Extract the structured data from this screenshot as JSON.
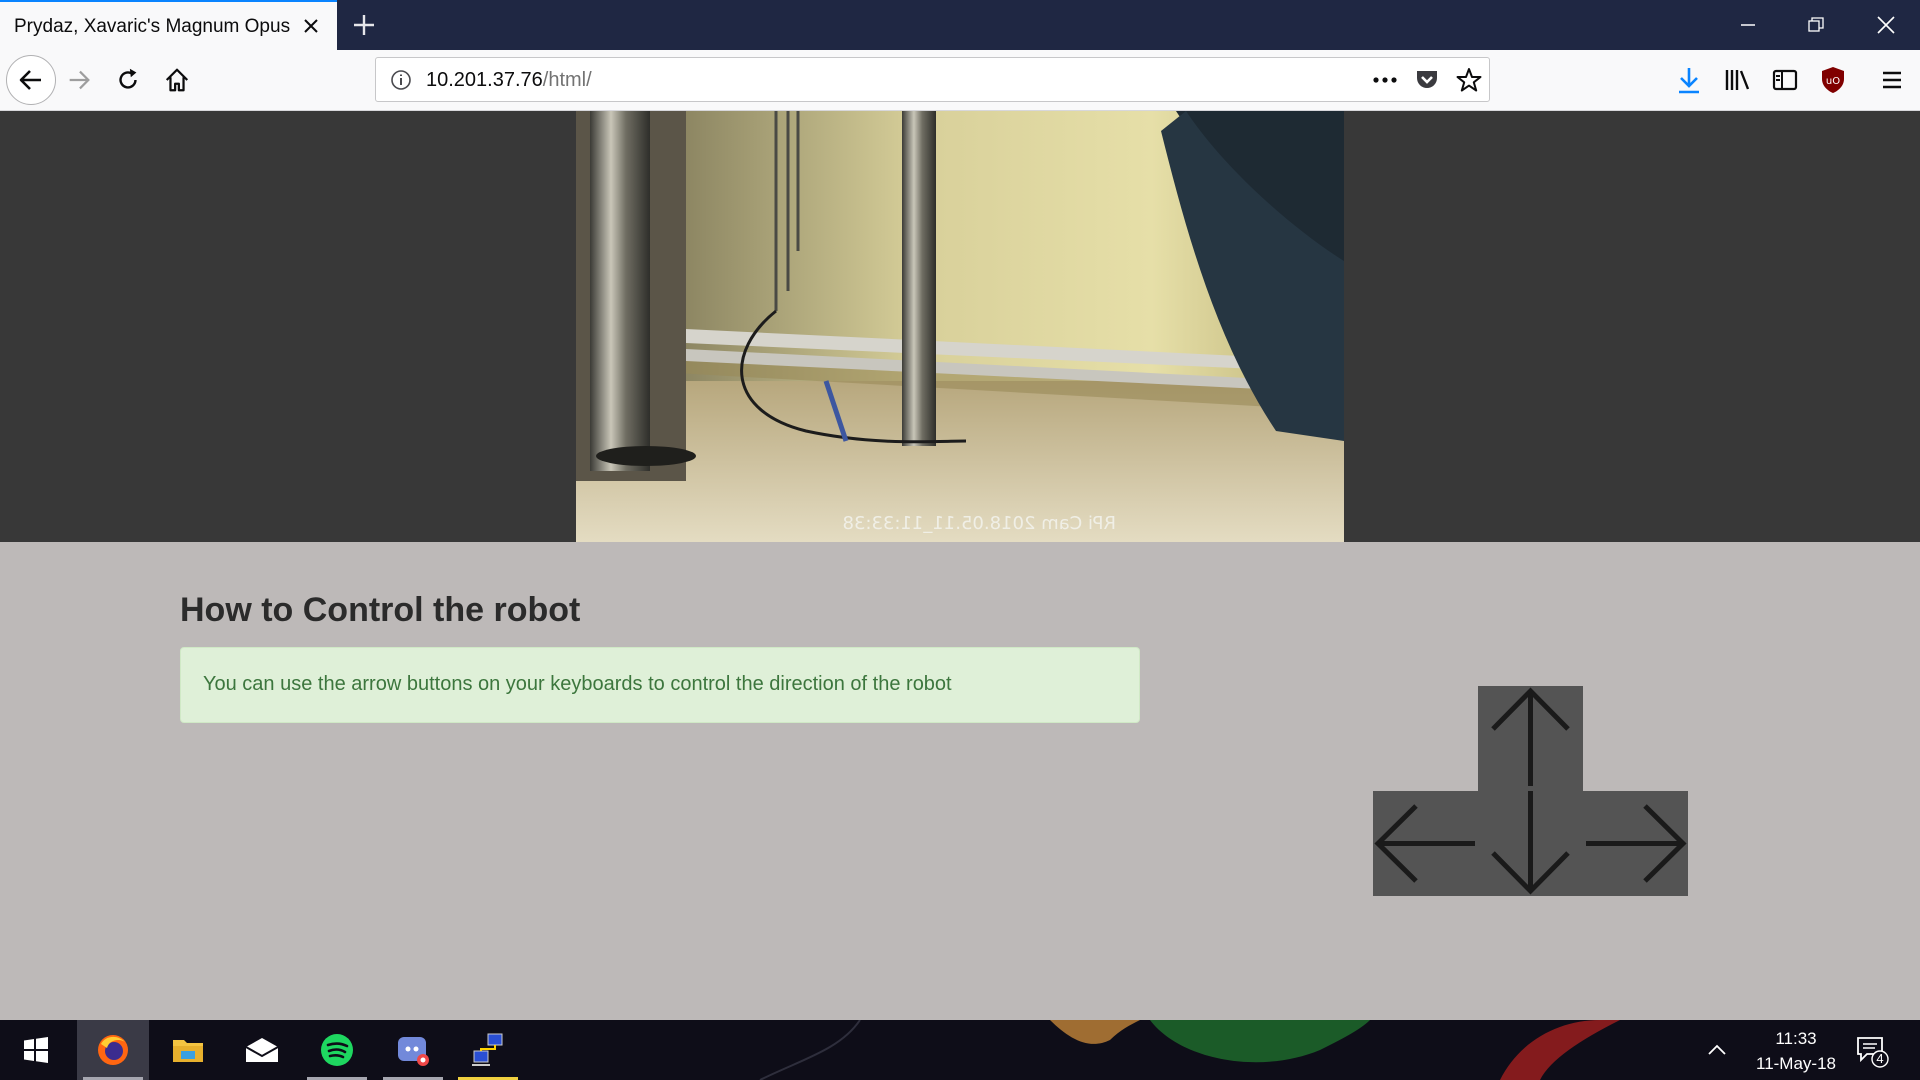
{
  "browser": {
    "tab_title": "Prydaz, Xavaric's Magnum Opus",
    "url_host": "10.201.37.76",
    "url_path": "/html/"
  },
  "camera": {
    "overlay_text": "RPi Cam  2018.05.11_11:33:38"
  },
  "page": {
    "heading": "How to Control the robot",
    "instructions": "You can use the arrow buttons on your keyboards to control the direction of the robot"
  },
  "arrow_keys": [
    "up",
    "left",
    "down",
    "right"
  ],
  "taskbar": {
    "apps": [
      "windows-start",
      "firefox",
      "file-explorer",
      "mail",
      "spotify",
      "discord",
      "network-app"
    ],
    "time": "11:33",
    "date": "11-May-18",
    "notification_count": "4"
  },
  "colors": {
    "accent": "#0a84ff",
    "page_bg": "#bdb9b8",
    "alert_bg": "#dff0d8",
    "alert_text": "#3c763d",
    "key_bg": "#545454"
  }
}
